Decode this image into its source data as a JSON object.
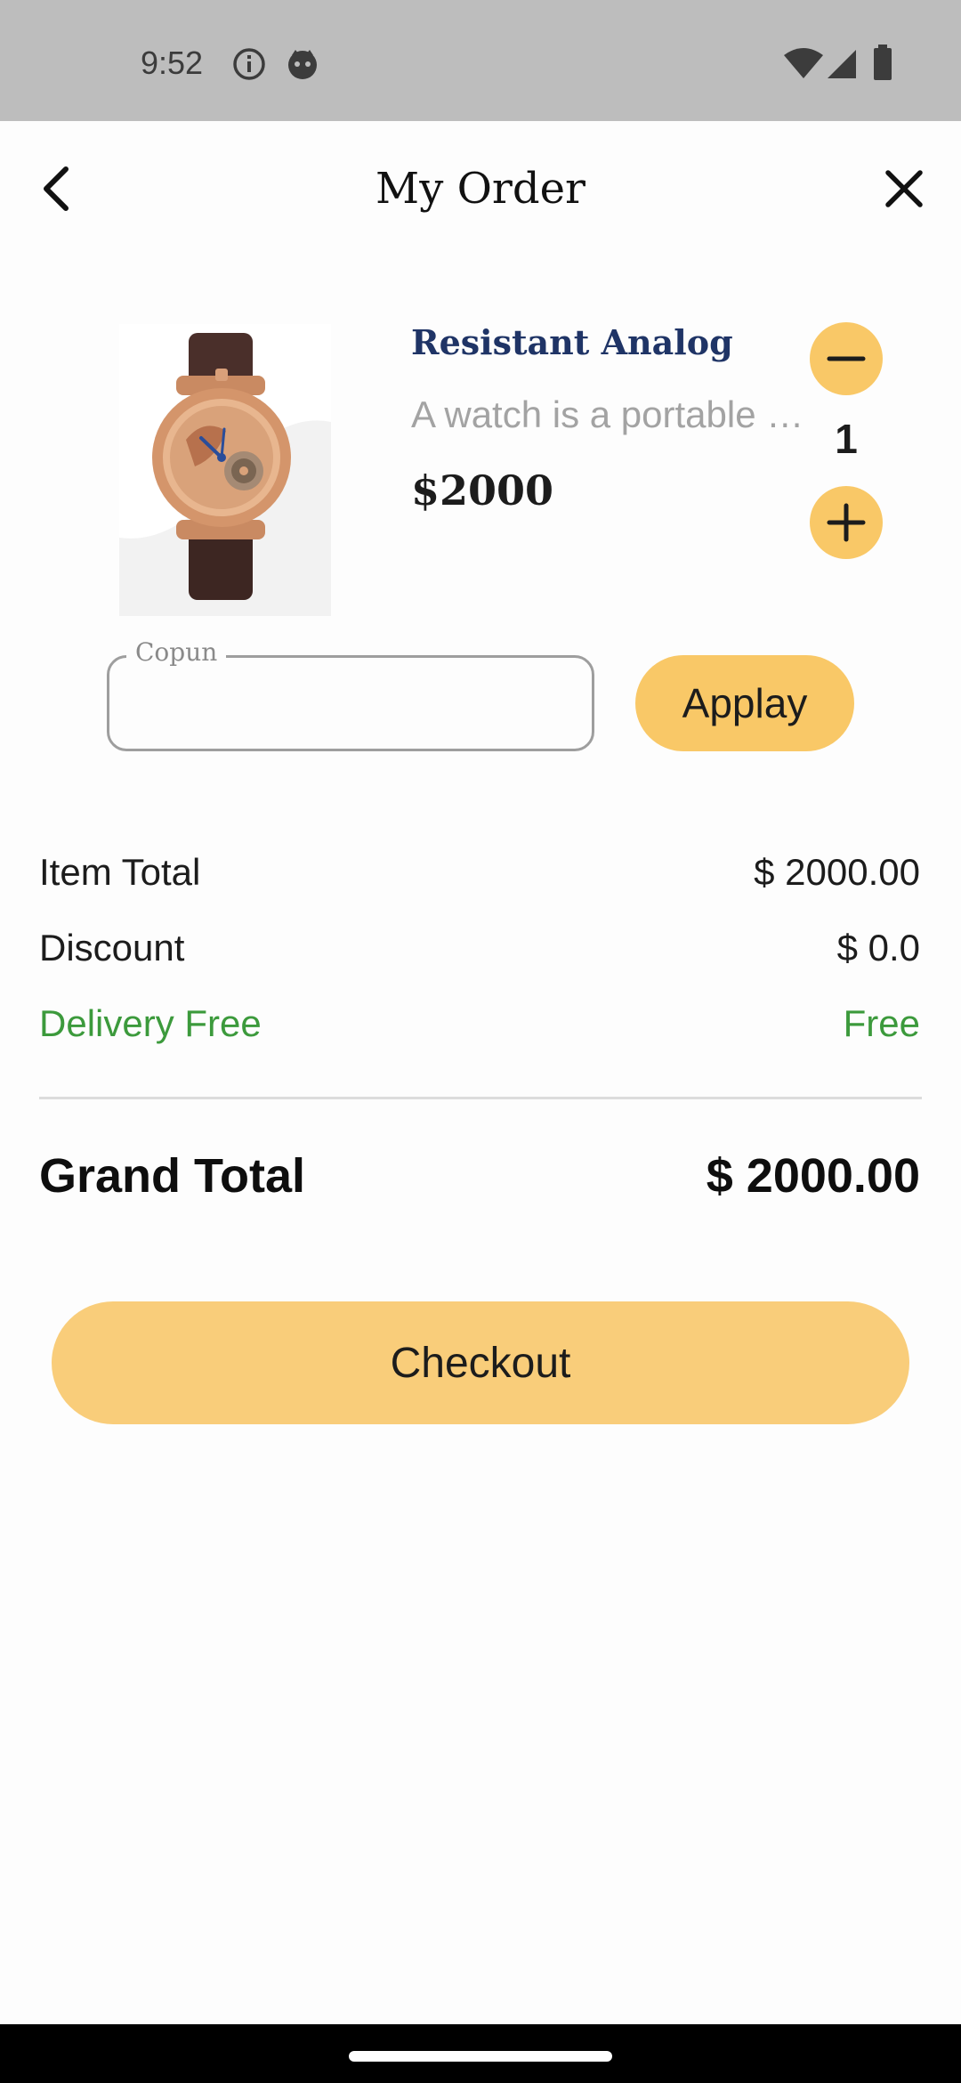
{
  "status_bar": {
    "time": "9:52",
    "icons": [
      "info-icon",
      "notification-app-icon",
      "wifi-icon",
      "cell-signal-icon",
      "battery-icon"
    ]
  },
  "app_bar": {
    "title": "My Order",
    "back_icon": "chevron-left-icon",
    "close_icon": "close-icon"
  },
  "product": {
    "name": "Resistant Analog",
    "description": "A watch is a portable timepiece intended to be carried or worn by a person",
    "price": "$2000",
    "quantity": "1",
    "image": "watch-image"
  },
  "coupon": {
    "label": "Copun",
    "value": "",
    "apply_label": "Applay"
  },
  "summary": {
    "item_total_label": "Item Total",
    "item_total_value": "$ 2000.00",
    "discount_label": "Discount",
    "discount_value": "$ 0.0",
    "delivery_label": "Delivery Free",
    "delivery_value": "Free",
    "grand_total_label": "Grand Total",
    "grand_total_value": "$ 2000.00"
  },
  "checkout_label": "Checkout",
  "colors": {
    "accent": "#f9c867",
    "checkout": "#f9cd7a",
    "product_name": "#1f3466",
    "delivery_green": "#3c9a3c",
    "status_bar": "#bdbdbd"
  }
}
